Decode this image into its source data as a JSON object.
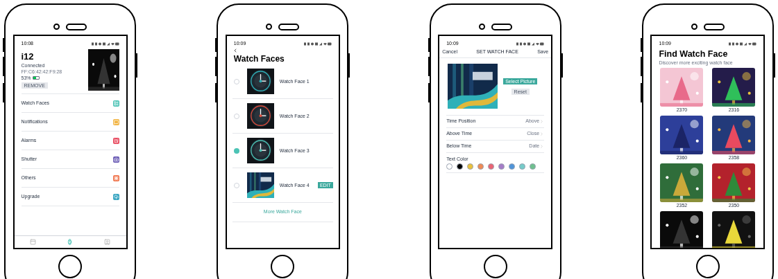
{
  "phones": [
    {
      "kind": "device",
      "status_time": "10:08",
      "device_name": "i12",
      "connection": "Connected",
      "mac": "FF:C6:42:42:F9:28",
      "battery": "53%",
      "remove_button": "REMOVE",
      "menu": [
        {
          "label": "Watch Faces",
          "color": "#4cc3b5"
        },
        {
          "label": "Notifications",
          "color": "#f2b544"
        },
        {
          "label": "Alarms",
          "color": "#e84a5f"
        },
        {
          "label": "Shutter",
          "color": "#6a5bb5"
        },
        {
          "label": "Others",
          "color": "#f0734a"
        },
        {
          "label": "Upgrade",
          "color": "#3aa6c2"
        }
      ],
      "nav": [
        {
          "selected": false
        },
        {
          "selected": true
        },
        {
          "selected": false
        }
      ]
    },
    {
      "kind": "faces",
      "status_time": "10:09",
      "title": "Watch Faces",
      "faces": [
        {
          "label": "Watch Face 1",
          "selected": false
        },
        {
          "label": "Watch Face 2",
          "selected": false
        },
        {
          "label": "Watch Face 3",
          "selected": true
        },
        {
          "label": "Watch Face 4",
          "selected": false,
          "edit": "EDIT"
        }
      ],
      "more": "More Watch Face"
    },
    {
      "kind": "editor",
      "status_time": "10:09",
      "cancel": "Cancel",
      "title": "SET WATCH FACE",
      "save": "Save",
      "select_picture": "Select Picture",
      "reset": "Reset",
      "settings": [
        {
          "label": "Time Position",
          "value": "Above"
        },
        {
          "label": "Above Time",
          "value": "Close"
        },
        {
          "label": "Below Time",
          "value": "Date"
        }
      ],
      "text_color_label": "Text Color",
      "colors": [
        {
          "color": "#ffffff"
        },
        {
          "color": "#000000"
        },
        {
          "color": "#e9c13c"
        },
        {
          "color": "#ef8a55"
        },
        {
          "color": "#ea6474"
        },
        {
          "color": "#a57dc7"
        },
        {
          "color": "#4f94d8"
        },
        {
          "color": "#76cbc9"
        },
        {
          "color": "#6fc08f"
        }
      ]
    },
    {
      "kind": "store",
      "status_time": "10:09",
      "title": "Find Watch Face",
      "subtitle": "Discover more exciting watch face",
      "faces": [
        {
          "kind": "picture",
          "code": "2370"
        },
        {
          "kind": "picture",
          "code": "2316"
        },
        {
          "kind": "picture",
          "code": "2360"
        },
        {
          "kind": "picture",
          "code": "2358"
        },
        {
          "kind": "picture",
          "code": "2352"
        },
        {
          "kind": "picture",
          "code": "2350"
        },
        {
          "kind": "picture"
        },
        {
          "kind": "picture"
        }
      ]
    }
  ]
}
